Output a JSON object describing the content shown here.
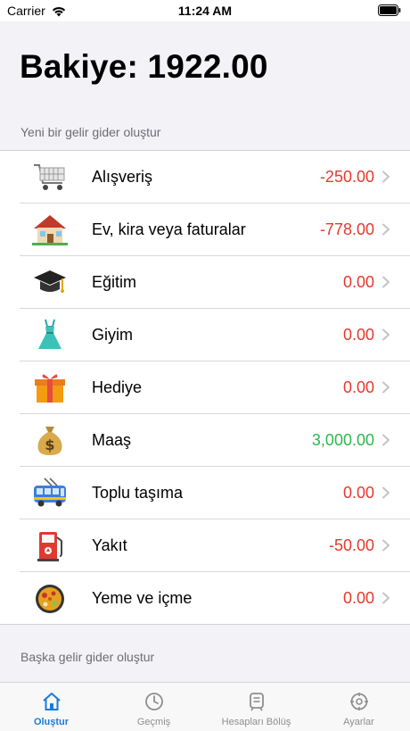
{
  "status_bar": {
    "carrier": "Carrier",
    "time": "11:24 AM"
  },
  "header": {
    "balance": "Bakiye: 1922.00",
    "create_label": "Yeni bir gelir gider oluştur"
  },
  "categories": [
    {
      "label": "Alışveriş",
      "amount": "-250.00",
      "kind": "neg",
      "icon": "shopping-cart-icon"
    },
    {
      "label": "Ev, kira veya faturalar",
      "amount": "-778.00",
      "kind": "neg",
      "icon": "house-icon"
    },
    {
      "label": "Eğitim",
      "amount": "0.00",
      "kind": "neg",
      "icon": "graduation-cap-icon"
    },
    {
      "label": "Giyim",
      "amount": "0.00",
      "kind": "neg",
      "icon": "dress-icon"
    },
    {
      "label": "Hediye",
      "amount": "0.00",
      "kind": "neg",
      "icon": "gift-icon"
    },
    {
      "label": "Maaş",
      "amount": "3,000.00",
      "kind": "pos",
      "icon": "money-bag-icon"
    },
    {
      "label": "Toplu taşıma",
      "amount": "0.00",
      "kind": "neg",
      "icon": "bus-icon"
    },
    {
      "label": "Yakıt",
      "amount": "-50.00",
      "kind": "neg",
      "icon": "fuel-pump-icon"
    },
    {
      "label": "Yeme ve içme",
      "amount": "0.00",
      "kind": "neg",
      "icon": "food-pan-icon"
    }
  ],
  "other_label": "Başka gelir gider oluştur",
  "tabs": [
    {
      "label": "Oluştur",
      "icon": "home-icon",
      "active": true
    },
    {
      "label": "Geçmiş",
      "icon": "clock-icon",
      "active": false
    },
    {
      "label": "Hesapları Bölüş",
      "icon": "receipt-icon",
      "active": false
    },
    {
      "label": "Ayarlar",
      "icon": "gear-icon",
      "active": false
    }
  ],
  "colors": {
    "negative": "#e5392e",
    "positive": "#2db84d",
    "accent": "#1a7bd8"
  }
}
